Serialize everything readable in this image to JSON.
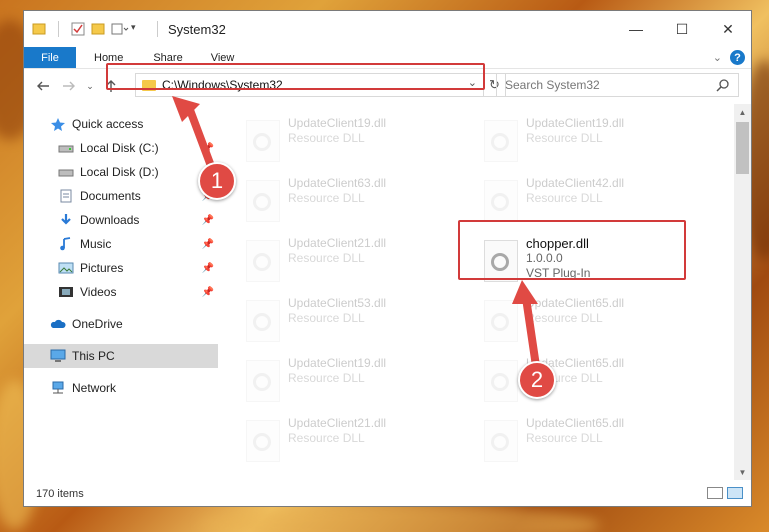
{
  "window": {
    "title": "System32",
    "controls": {
      "minimize": "—",
      "maximize": "☐",
      "close": "✕"
    }
  },
  "ribbon": {
    "tabs": [
      "File",
      "Home",
      "Share",
      "View"
    ]
  },
  "nav": {
    "address": "C:\\Windows\\System32",
    "search_placeholder": "Search System32"
  },
  "sidebar": {
    "items": [
      {
        "label": "Quick access",
        "icon": "star-icon"
      },
      {
        "label": "Local Disk (C:)",
        "icon": "drive-icon",
        "pinned": true
      },
      {
        "label": "Local Disk (D:)",
        "icon": "drive-icon",
        "pinned": true
      },
      {
        "label": "Documents",
        "icon": "documents-icon",
        "pinned": true
      },
      {
        "label": "Downloads",
        "icon": "download-icon",
        "pinned": true
      },
      {
        "label": "Music",
        "icon": "music-icon",
        "pinned": true
      },
      {
        "label": "Pictures",
        "icon": "pictures-icon",
        "pinned": true
      },
      {
        "label": "Videos",
        "icon": "videos-icon",
        "pinned": true
      },
      {
        "label": "OneDrive",
        "icon": "cloud-icon"
      },
      {
        "label": "This PC",
        "icon": "pc-icon",
        "selected": true
      },
      {
        "label": "Network",
        "icon": "network-icon"
      }
    ]
  },
  "files": [
    {
      "name": "UpdateClient19.dll",
      "type": "Resource DLL"
    },
    {
      "name": "UpdateClient19.dll",
      "type": "Resource DLL"
    },
    {
      "name": "UpdateClient63.dll",
      "type": "Resource DLL"
    },
    {
      "name": "UpdateClient42.dll",
      "type": "Resource DLL"
    },
    {
      "name": "UpdateClient21.dll",
      "type": "Resource DLL"
    },
    {
      "name": "chopper.dll",
      "version": "1.0.0.0",
      "type": "VST Plug-In",
      "highlighted": true
    },
    {
      "name": "UpdateClient53.dll",
      "type": "Resource DLL"
    },
    {
      "name": "UpdateClient65.dll",
      "type": "Resource DLL"
    },
    {
      "name": "UpdateClient19.dll",
      "type": "Resource DLL"
    },
    {
      "name": "UpdateClient65.dll",
      "type": "Resource DLL"
    },
    {
      "name": "UpdateClient21.dll",
      "type": "Resource DLL"
    },
    {
      "name": "UpdateClient65.dll",
      "type": "Resource DLL"
    }
  ],
  "status": {
    "item_count": "170 items"
  },
  "callouts": {
    "one": "1",
    "two": "2"
  },
  "colors": {
    "accent": "#1979ca",
    "callout": "#e04a44",
    "highlight": "#d23a3a"
  }
}
